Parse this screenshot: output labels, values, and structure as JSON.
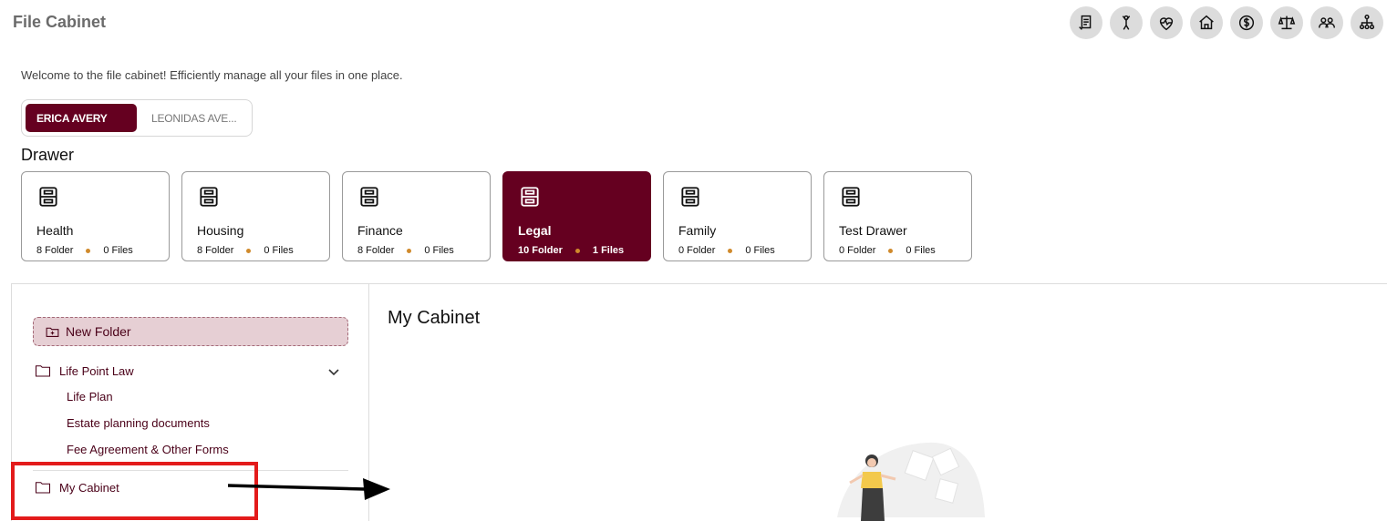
{
  "app_title": "File Cabinet",
  "header_icons": [
    "document-icon",
    "celebrate-icon",
    "heartbeat-icon",
    "home-icon",
    "dollar-icon",
    "scales-icon",
    "people-icon",
    "org-chart-icon"
  ],
  "welcome_text": "Welcome to the file cabinet! Efficiently manage all your files in one place.",
  "user_tabs": [
    {
      "label": "ERICA AVERY",
      "active": true
    },
    {
      "label": "LEONIDAS AVE...",
      "active": false
    }
  ],
  "drawer_heading": "Drawer",
  "drawers": [
    {
      "name": "Health",
      "folders": "8 Folder",
      "files": "0 Files",
      "active": false
    },
    {
      "name": "Housing",
      "folders": "8 Folder",
      "files": "0 Files",
      "active": false
    },
    {
      "name": "Finance",
      "folders": "8 Folder",
      "files": "0 Files",
      "active": false
    },
    {
      "name": "Legal",
      "folders": "10 Folder",
      "files": "1 Files",
      "active": true
    },
    {
      "name": "Family",
      "folders": "0 Folder",
      "files": "0 Files",
      "active": false
    },
    {
      "name": "Test Drawer",
      "folders": "0 Folder",
      "files": "0 Files",
      "active": false
    }
  ],
  "sidebar": {
    "new_folder_label": "New Folder",
    "folder_group": "Life Point Law",
    "sub_items": [
      "Life Plan",
      "Estate planning documents",
      "Fee Agreement & Other Forms"
    ],
    "my_cabinet": "My Cabinet"
  },
  "main": {
    "title": "My Cabinet"
  },
  "colors": {
    "accent": "#650020",
    "highlight": "#e31b1b",
    "dot": "#d08a2c"
  }
}
